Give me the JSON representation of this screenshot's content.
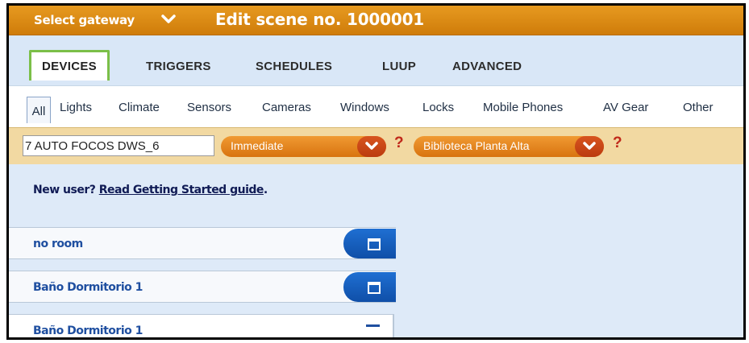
{
  "header": {
    "gateway_label": "Select gateway",
    "scene_title": "Edit scene no. 1000001",
    "accent": "#d9830f"
  },
  "tabs": [
    {
      "label": "DEVICES",
      "active": true
    },
    {
      "label": "TRIGGERS"
    },
    {
      "label": "SCHEDULES"
    },
    {
      "label": "LUUP"
    },
    {
      "label": "ADVANCED"
    }
  ],
  "filters": [
    {
      "label": "All",
      "active": true
    },
    {
      "label": "Lights"
    },
    {
      "label": "Climate"
    },
    {
      "label": "Sensors"
    },
    {
      "label": "Cameras"
    },
    {
      "label": "Windows"
    },
    {
      "label": "Locks"
    },
    {
      "label": "Mobile Phones"
    },
    {
      "label": "AV Gear"
    },
    {
      "label": "Other"
    }
  ],
  "actions": {
    "device_value": "7 AUTO FOCOS DWS_6",
    "timing_selected": "Immediate",
    "room_selected": "Biblioteca Planta Alta",
    "help": "?"
  },
  "content": {
    "newuser_prefix": "New user?",
    "newuser_link": "Read Getting Started guide",
    "newuser_suffix": "."
  },
  "rooms": [
    {
      "name": "no room",
      "state": "collapsed"
    },
    {
      "name": "Baño Dormitorio 1",
      "state": "collapsed"
    },
    {
      "name": "Baño Dormitorio 1",
      "state": "expanded"
    }
  ]
}
